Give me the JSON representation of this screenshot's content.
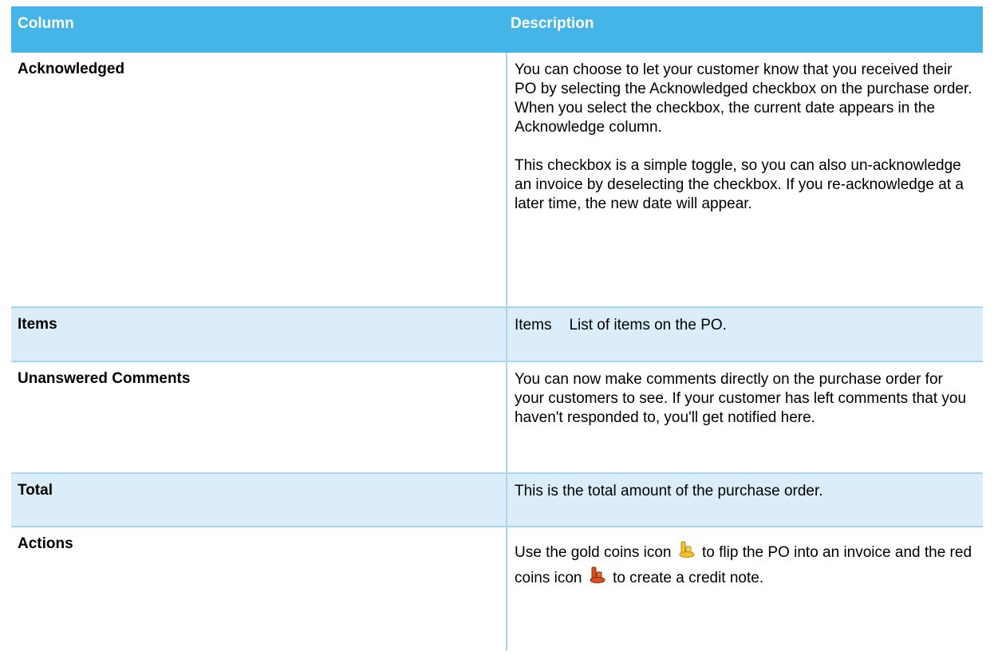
{
  "table": {
    "headers": {
      "column": "Column",
      "description": "Description"
    },
    "rows": [
      {
        "column": "Acknowledged",
        "paragraphs": [
          "You can choose to let your customer know that you received their PO by selecting the Acknowledged checkbox on the purchase order. When you select the checkbox, the current date appears in the Acknowledge column.",
          "This checkbox is a simple toggle, so you can also un-acknowledge an invoice by deselecting the checkbox. If you re-acknowledge at a later time, the new date will appear."
        ]
      },
      {
        "column": "Items",
        "term": "Items",
        "description": "List of items on the PO."
      },
      {
        "column": "Unanswered Comments",
        "description": "You can now make comments directly on the purchase order for your customers to see. If your customer has left comments that you haven't responded to, you'll get notified here."
      },
      {
        "column": "Total",
        "description": "This is the total amount of the purchase order."
      },
      {
        "column": "Actions",
        "parts": [
          "Use the gold coins icon",
          "to flip the PO into an invoice and the red coins icon",
          "to create a credit note."
        ],
        "icons": [
          "gold-coins-icon",
          "red-coins-icon"
        ]
      }
    ]
  },
  "colors": {
    "header_bg": "#45b5e7",
    "row_highlight": "#daedf9",
    "rule": "#a9d6ef",
    "gold_coin": "#f2c230",
    "red_coin": "#d9531e"
  }
}
